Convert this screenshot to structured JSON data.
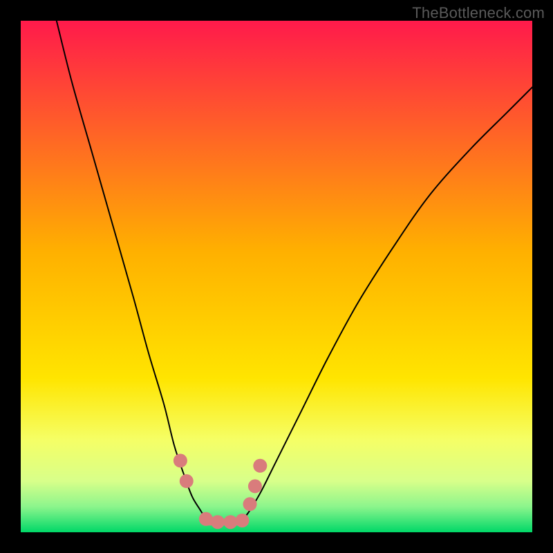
{
  "watermark": "TheBottleneck.com",
  "chart_data": {
    "type": "line",
    "title": "",
    "xlabel": "",
    "ylabel": "",
    "xlim": [
      0,
      100
    ],
    "ylim": [
      0,
      100
    ],
    "background_gradient": {
      "stops": [
        {
          "offset": 0.0,
          "color": "#ff1a4b"
        },
        {
          "offset": 0.45,
          "color": "#ffb000"
        },
        {
          "offset": 0.7,
          "color": "#ffe500"
        },
        {
          "offset": 0.82,
          "color": "#f5ff66"
        },
        {
          "offset": 0.9,
          "color": "#d8ff8a"
        },
        {
          "offset": 0.95,
          "color": "#8cf58c"
        },
        {
          "offset": 1.0,
          "color": "#00d868"
        }
      ]
    },
    "series": [
      {
        "name": "left-curve",
        "stroke": "#000000",
        "x": [
          7,
          10,
          14,
          18,
          22,
          25,
          28,
          30,
          32,
          33.5,
          35,
          36,
          37,
          38
        ],
        "values": [
          100,
          88,
          74,
          60,
          46,
          35,
          25,
          17,
          11,
          7,
          4.5,
          3,
          2.2,
          2
        ]
      },
      {
        "name": "right-curve",
        "stroke": "#000000",
        "x": [
          42,
          43,
          44,
          45,
          47,
          50,
          55,
          60,
          66,
          73,
          80,
          88,
          95,
          100
        ],
        "values": [
          2,
          2.3,
          3.2,
          4.6,
          8,
          14,
          24,
          34,
          45,
          56,
          66,
          75,
          82,
          87
        ]
      }
    ],
    "flat_segment": {
      "y": 2,
      "x_start": 36.5,
      "x_end": 43.5,
      "stroke": "#d97c7c",
      "stroke_width": 10
    },
    "highlight_points": {
      "color": "#d97c7c",
      "radius": 10,
      "points": [
        {
          "x": 31.2,
          "y": 14
        },
        {
          "x": 32.4,
          "y": 10
        },
        {
          "x": 36.2,
          "y": 2.6
        },
        {
          "x": 38.5,
          "y": 2
        },
        {
          "x": 41.0,
          "y": 2
        },
        {
          "x": 43.3,
          "y": 2.3
        },
        {
          "x": 44.8,
          "y": 5.5
        },
        {
          "x": 45.8,
          "y": 9
        },
        {
          "x": 46.8,
          "y": 13
        }
      ]
    }
  }
}
